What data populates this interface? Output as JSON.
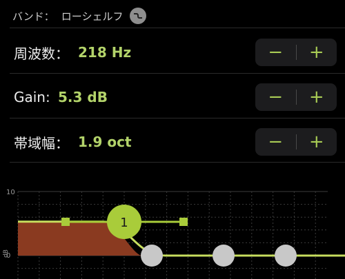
{
  "band": {
    "label": "バンド：",
    "name": "ローシェルフ",
    "icon": "low-shelf-icon"
  },
  "params": [
    {
      "label": "周波数：",
      "value": "218 Hz"
    },
    {
      "label": "Gain:",
      "value": "5.3 dB"
    },
    {
      "label": "帯域幅：",
      "value": "1.9 oct"
    }
  ],
  "stepper": {
    "minus": "−",
    "plus": "+"
  },
  "graph": {
    "y_top_label": "10",
    "y_zero_label": "0",
    "y_unit": "dB",
    "band_number": "1",
    "colors": {
      "curve": "#c7de5e",
      "fill": "#8a3a20",
      "node": "#a9cc3a",
      "handle": "#c8c8c8"
    }
  },
  "chart_data": {
    "type": "line",
    "ylabel": "dB",
    "ylim": [
      0,
      10
    ],
    "series": [
      {
        "values": [
          5.3,
          5.3,
          0,
          0
        ]
      }
    ]
  }
}
